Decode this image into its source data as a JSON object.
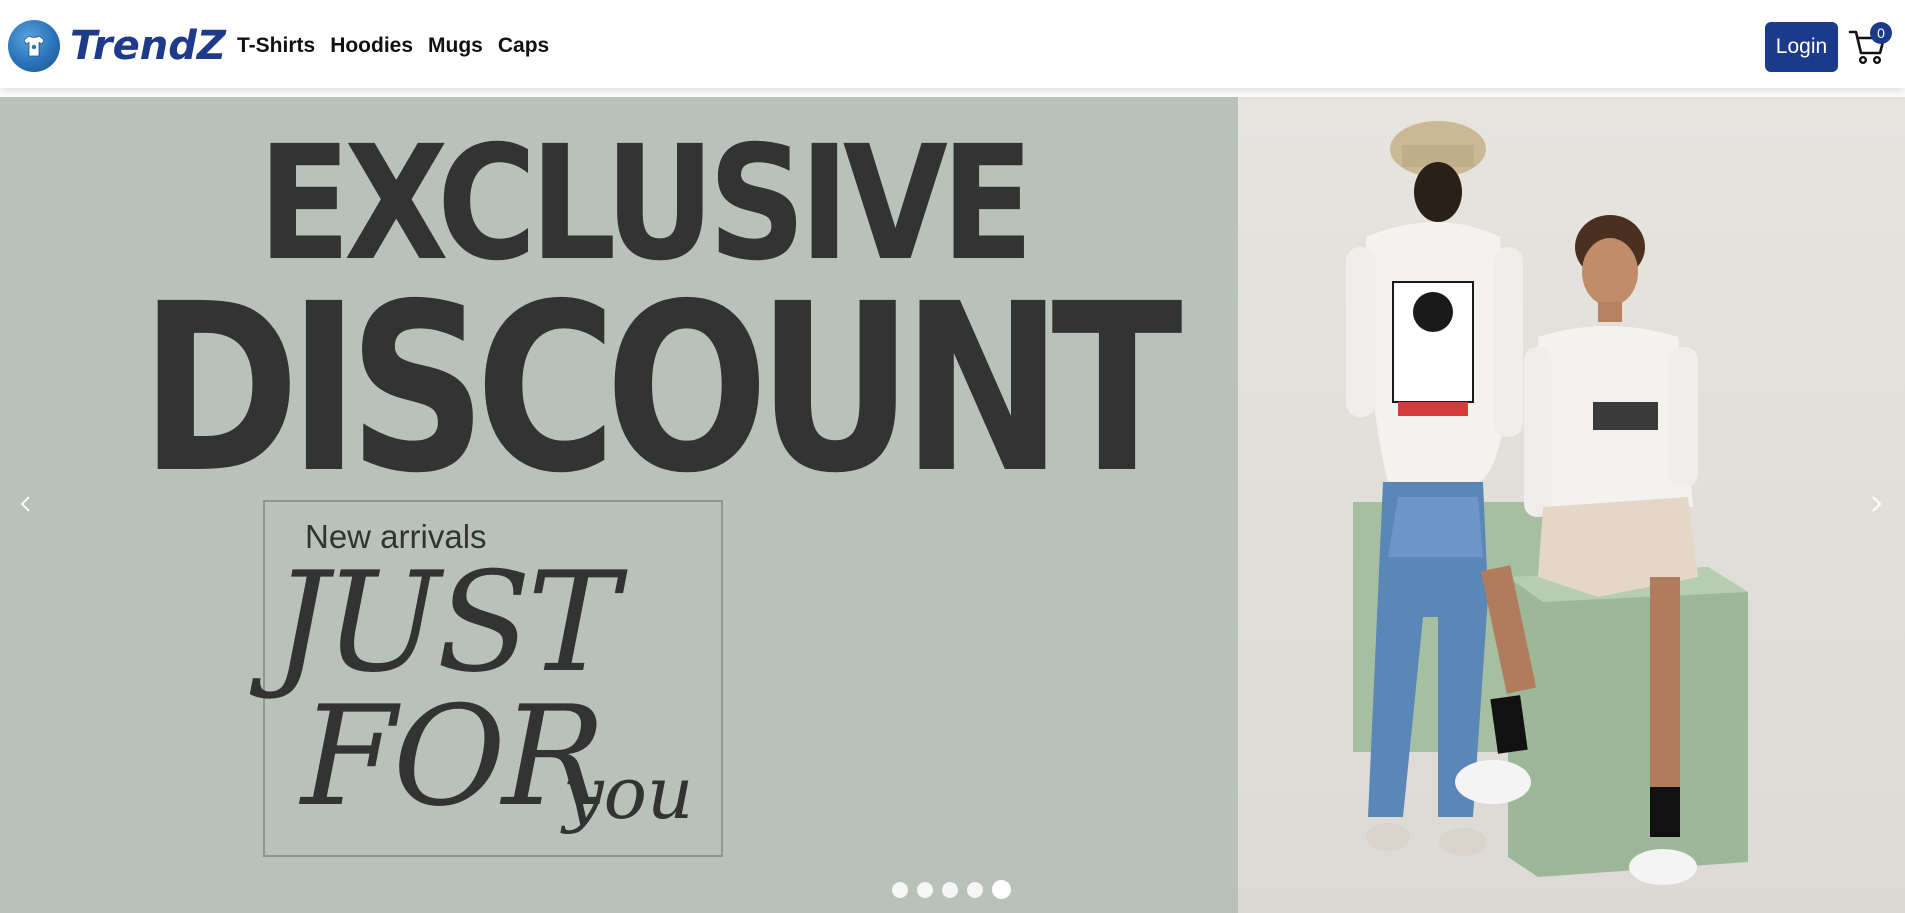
{
  "navbar": {
    "brand": "TrendZ",
    "links": [
      "T-Shirts",
      "Hoodies",
      "Mugs",
      "Caps"
    ],
    "login_label": "Login",
    "cart_count": "0"
  },
  "hero": {
    "line1": "EXCLUSIVE",
    "line2": "DISCOUNT",
    "sub": "New arrivals",
    "just": "JUST",
    "for": "FOR",
    "you": "you"
  },
  "carousel": {
    "slide_count": 5,
    "active_index": 4
  },
  "colors": {
    "brand": "#1f3a8a",
    "button": "#1c3a8c",
    "hero_bg": "#b8c2ba",
    "hero_text": "#333333"
  },
  "icons": [
    "tshirt-logo-icon",
    "cart-icon",
    "chevron-left-icon",
    "chevron-right-icon"
  ]
}
